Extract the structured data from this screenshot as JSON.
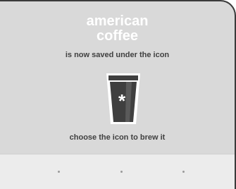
{
  "header": {
    "title_line1": "american",
    "title_line2": "coffee"
  },
  "message": {
    "saved_text": "is now saved under the icon",
    "instruction_text": "choose the icon to brew it"
  },
  "icon": {
    "name": "coffee-cup-icon",
    "glyph": "*"
  },
  "pager": {
    "dots": 3
  },
  "colors": {
    "background": "#d9d9d9",
    "title": "#ffffff",
    "text": "#404040",
    "cup": "#3f3f3f",
    "bottom_bar": "#ececec"
  }
}
